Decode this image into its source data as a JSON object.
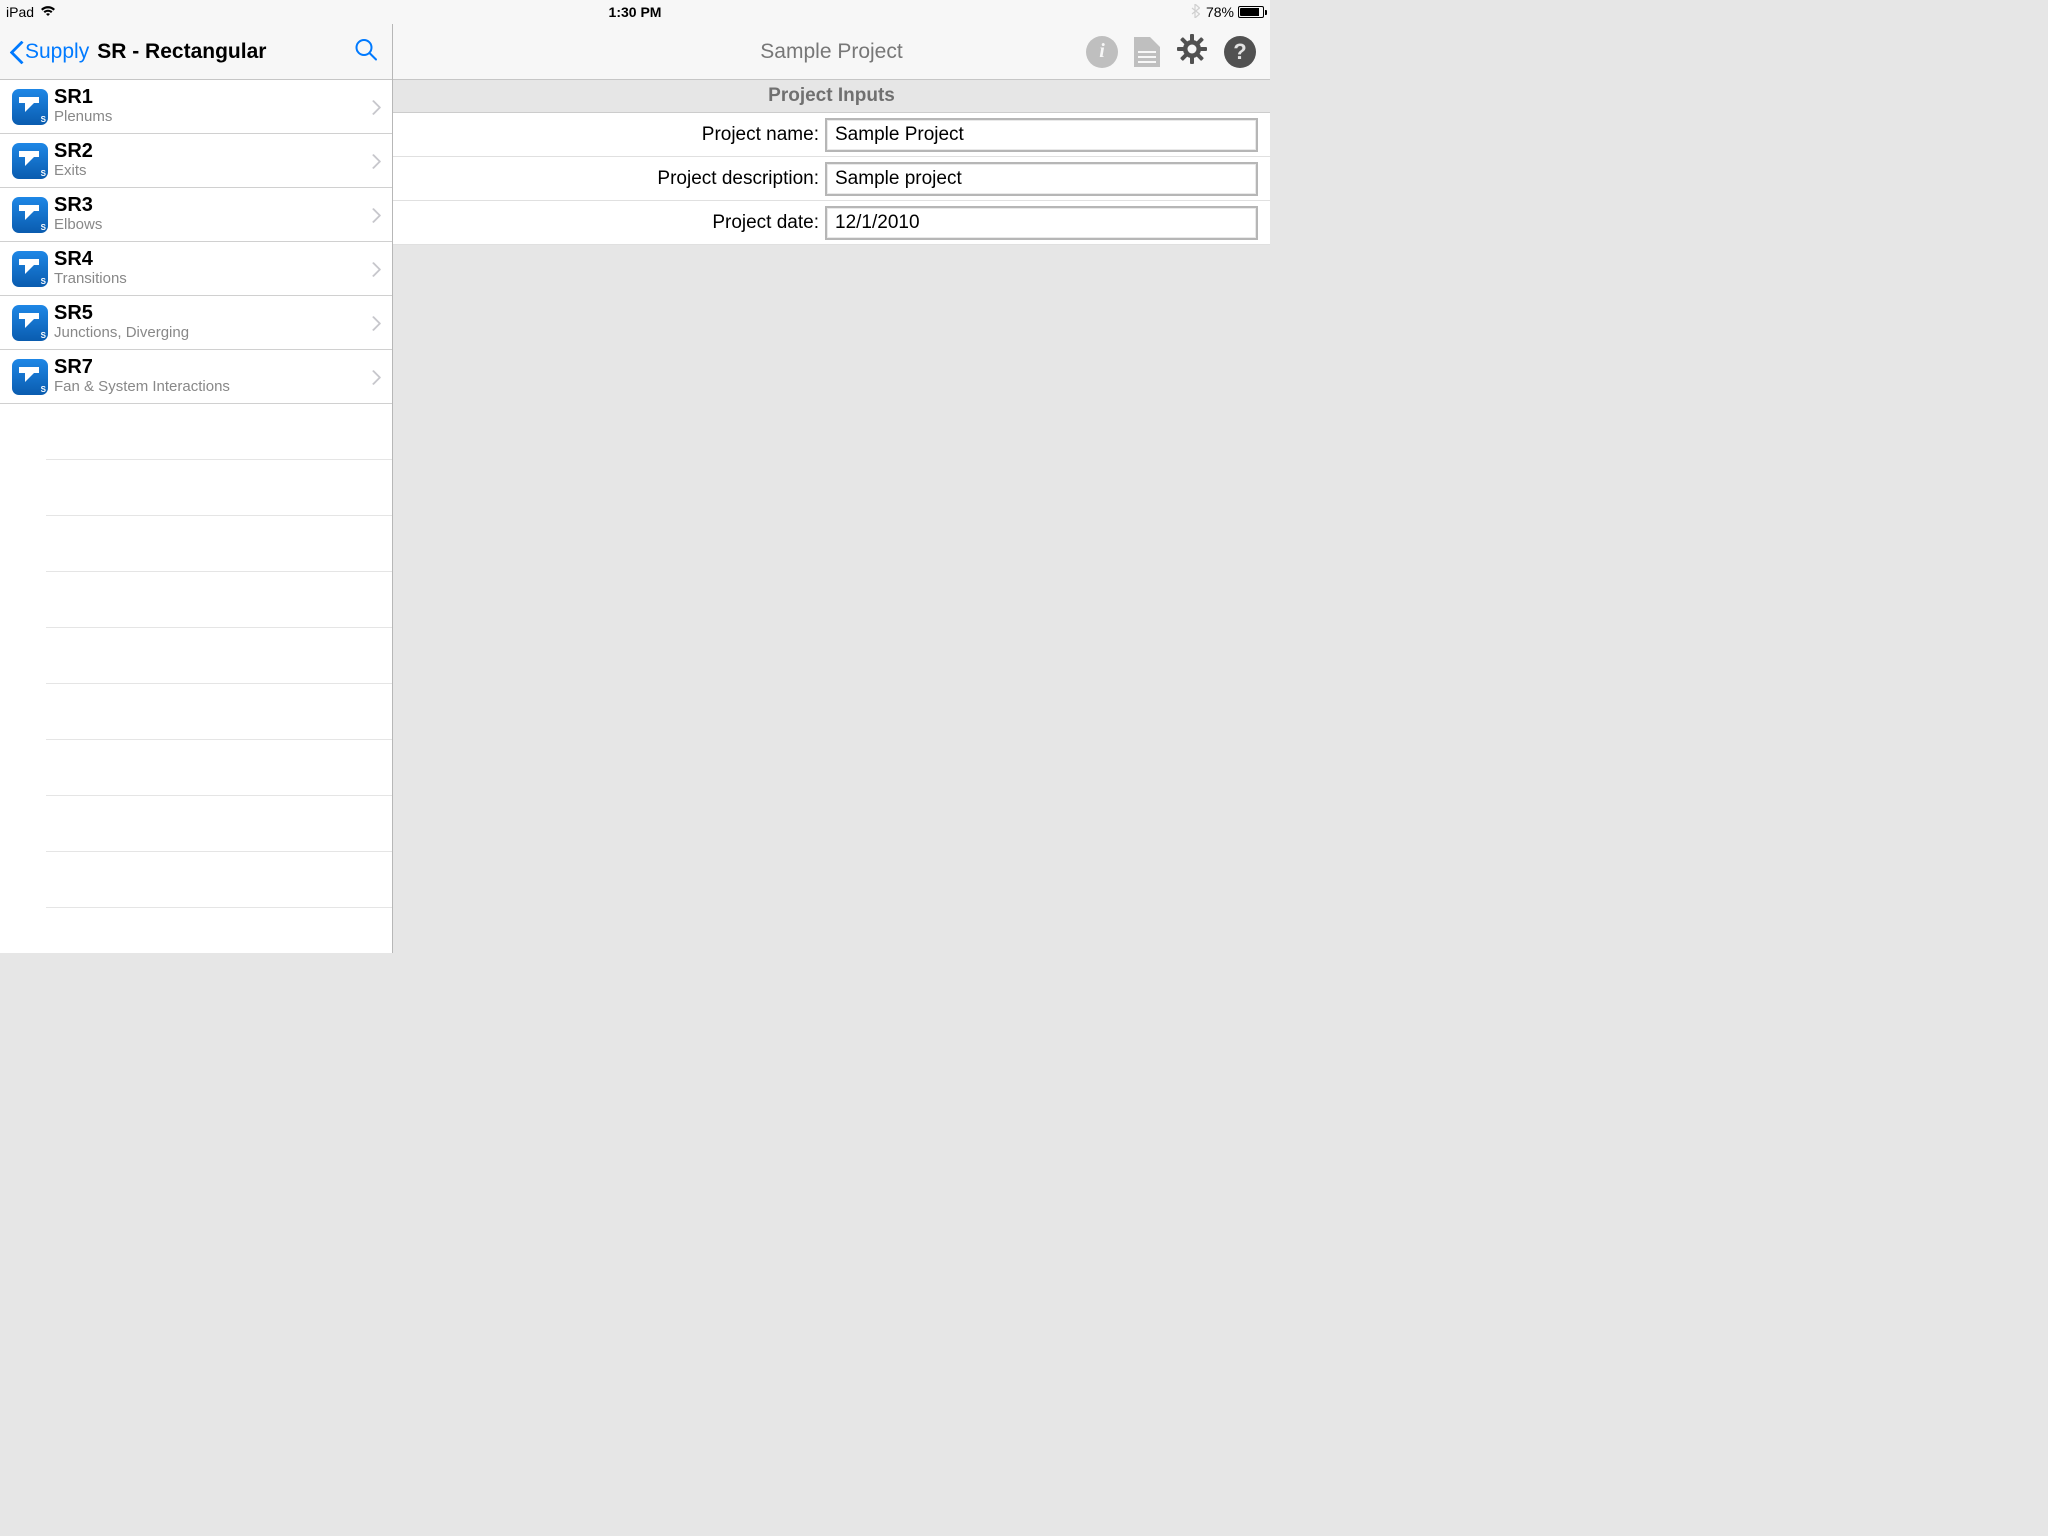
{
  "status": {
    "device": "iPad",
    "time": "1:30 PM",
    "battery": "78%"
  },
  "sidebar": {
    "back_label": "Supply",
    "title": "SR - Rectangular",
    "items": [
      {
        "title": "SR1",
        "sub": "Plenums"
      },
      {
        "title": "SR2",
        "sub": "Exits"
      },
      {
        "title": "SR3",
        "sub": "Elbows"
      },
      {
        "title": "SR4",
        "sub": "Transitions"
      },
      {
        "title": "SR5",
        "sub": "Junctions, Diverging"
      },
      {
        "title": "SR7",
        "sub": "Fan & System Interactions"
      }
    ]
  },
  "main": {
    "title": "Sample Project",
    "section_header": "Project Inputs",
    "fields": [
      {
        "label": "Project name:",
        "value": "Sample Project"
      },
      {
        "label": "Project description:",
        "value": "Sample project"
      },
      {
        "label": "Project date:",
        "value": "12/1/2010"
      }
    ]
  }
}
